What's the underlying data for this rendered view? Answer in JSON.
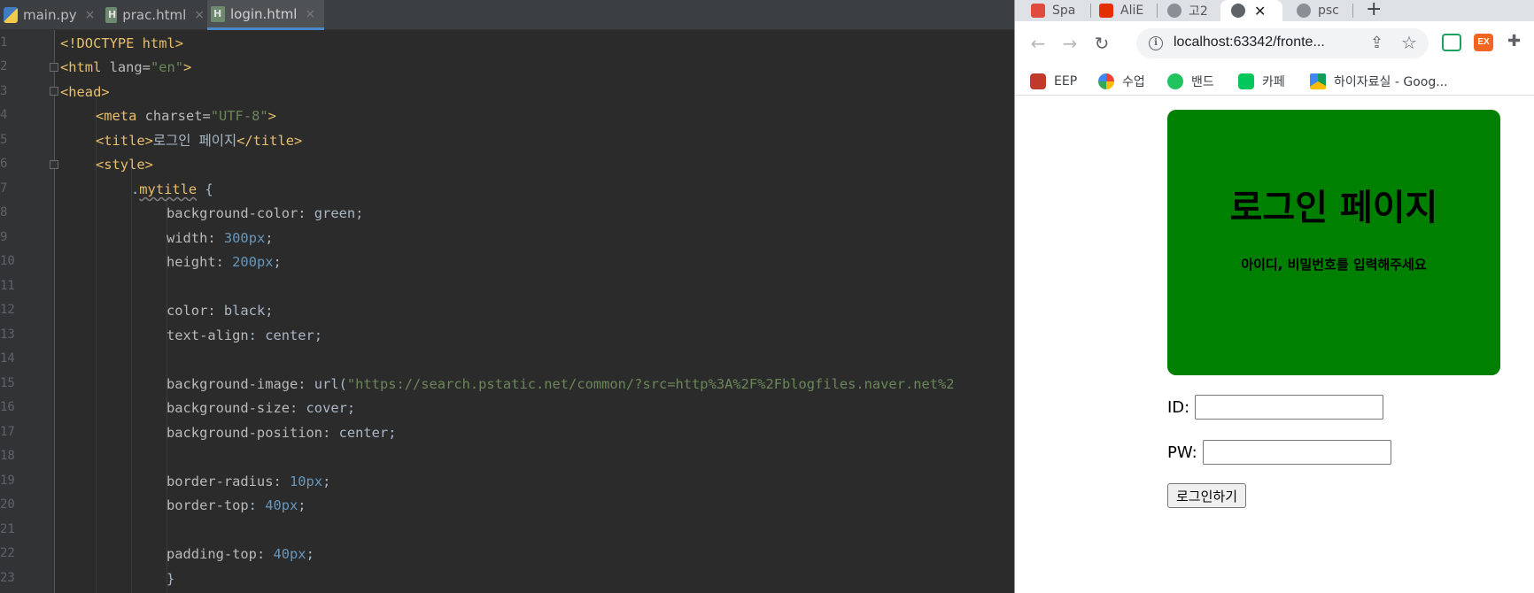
{
  "ide": {
    "tabs": [
      {
        "label": "main.py",
        "icon": "python-file-icon"
      },
      {
        "label": "prac.html",
        "icon": "html-file-icon"
      },
      {
        "label": "login.html",
        "icon": "html-file-icon",
        "active": true
      }
    ],
    "close_glyph": "×",
    "line_numbers": [
      "1",
      "2",
      "3",
      "4",
      "5",
      "6",
      "7",
      "8",
      "9",
      "10",
      "11",
      "12",
      "13",
      "14",
      "15",
      "16",
      "17",
      "18",
      "19",
      "20",
      "21",
      "22",
      "23"
    ]
  },
  "browser": {
    "tabs": [
      {
        "label": "Spa"
      },
      {
        "label": "AliE"
      },
      {
        "label": "고2"
      },
      {
        "label": "",
        "active": true
      },
      {
        "label": "psc"
      }
    ],
    "tab_close_glyph": "✕",
    "new_tab_glyph": "+",
    "url": "localhost:63342/fronte...",
    "bookmarks": [
      {
        "label": "EEP"
      },
      {
        "label": "수업"
      },
      {
        "label": "밴드"
      },
      {
        "label": "카페"
      },
      {
        "label": "하이자료실 - Goog..."
      }
    ],
    "extensions": [
      {
        "label": ""
      },
      {
        "label": "EX"
      },
      {
        "label": ""
      }
    ],
    "page": {
      "heading": "로그인 페이지",
      "subheading": "아이디, 비밀번호를 입력해주세요",
      "id_label": "ID:",
      "pw_label": "PW:",
      "login_button": "로그인하기"
    }
  },
  "colors": {
    "title_box_bg": "#008000",
    "ide_bg": "#2b2b2b",
    "ide_tag": "#e8bf6a",
    "ide_string": "#6a8759",
    "ide_number": "#6897bb"
  }
}
